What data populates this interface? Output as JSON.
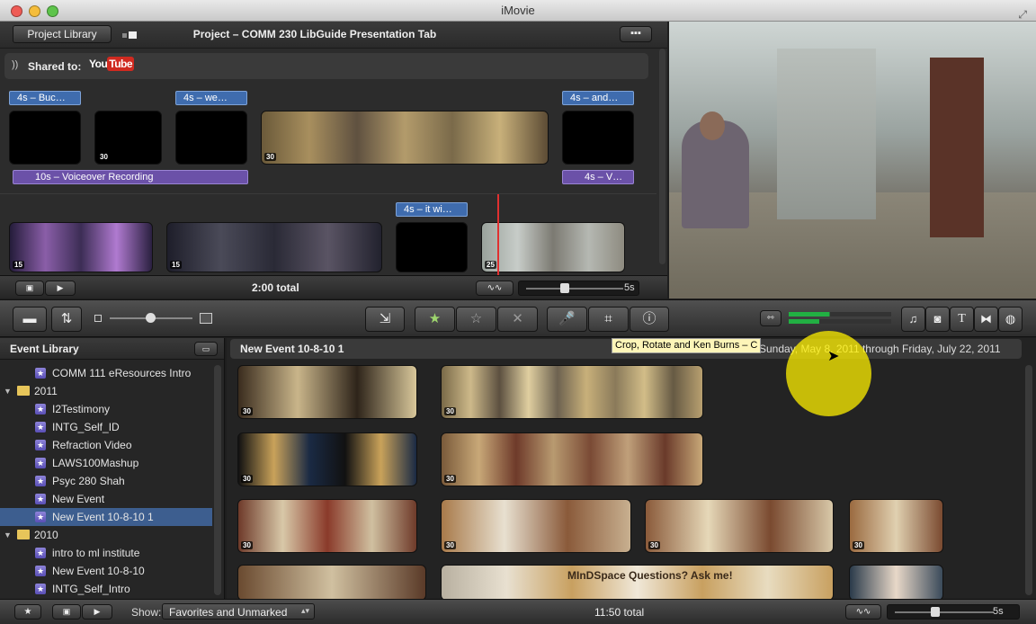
{
  "app": {
    "title": "iMovie"
  },
  "project": {
    "back_label": "Project Library",
    "title": "Project – COMM 230 LibGuide Presentation Tab",
    "shared_label": "Shared to:",
    "youtube": "YouTube",
    "total": "2:00 total",
    "zoom": "5s",
    "labels": [
      "4s – Buc…",
      "4s – we…",
      "4s – and…",
      "4s – it wi…"
    ],
    "voiceovers": [
      "10s – Voiceover Recording",
      "4s – V…"
    ],
    "durations": [
      "30",
      "30",
      "15",
      "15",
      "25"
    ]
  },
  "toolbar": {
    "tooltip": "Crop, Rotate and Ken Burns – C"
  },
  "library": {
    "header": "Event Library",
    "items": [
      {
        "type": "event",
        "label": "COMM 111 eResources Intro"
      },
      {
        "type": "year",
        "label": "2011"
      },
      {
        "type": "event",
        "label": "I2Testimony"
      },
      {
        "type": "event",
        "label": "INTG_Self_ID"
      },
      {
        "type": "event",
        "label": "Refraction Video"
      },
      {
        "type": "event",
        "label": "LAWS100Mashup"
      },
      {
        "type": "event",
        "label": "Psyc 280 Shah"
      },
      {
        "type": "event",
        "label": "New Event"
      },
      {
        "type": "event",
        "label": "New Event 10-8-10 1",
        "selected": true
      },
      {
        "type": "year",
        "label": "2010"
      },
      {
        "type": "event",
        "label": "intro to ml institute"
      },
      {
        "type": "event",
        "label": "New Event 10-8-10"
      },
      {
        "type": "event",
        "label": "INTG_Self_Intro"
      }
    ]
  },
  "event": {
    "title": "New Event 10-8-10 1",
    "range": "Sunday, May 8, 2011 through Friday, July 22, 2011",
    "dur": "30",
    "mindspace": "MInDSpace Questions? Ask me!"
  },
  "bottom": {
    "show_label": "Show:",
    "filter": "Favorites and Unmarked",
    "total": "11:50 total",
    "zoom": "5s"
  }
}
